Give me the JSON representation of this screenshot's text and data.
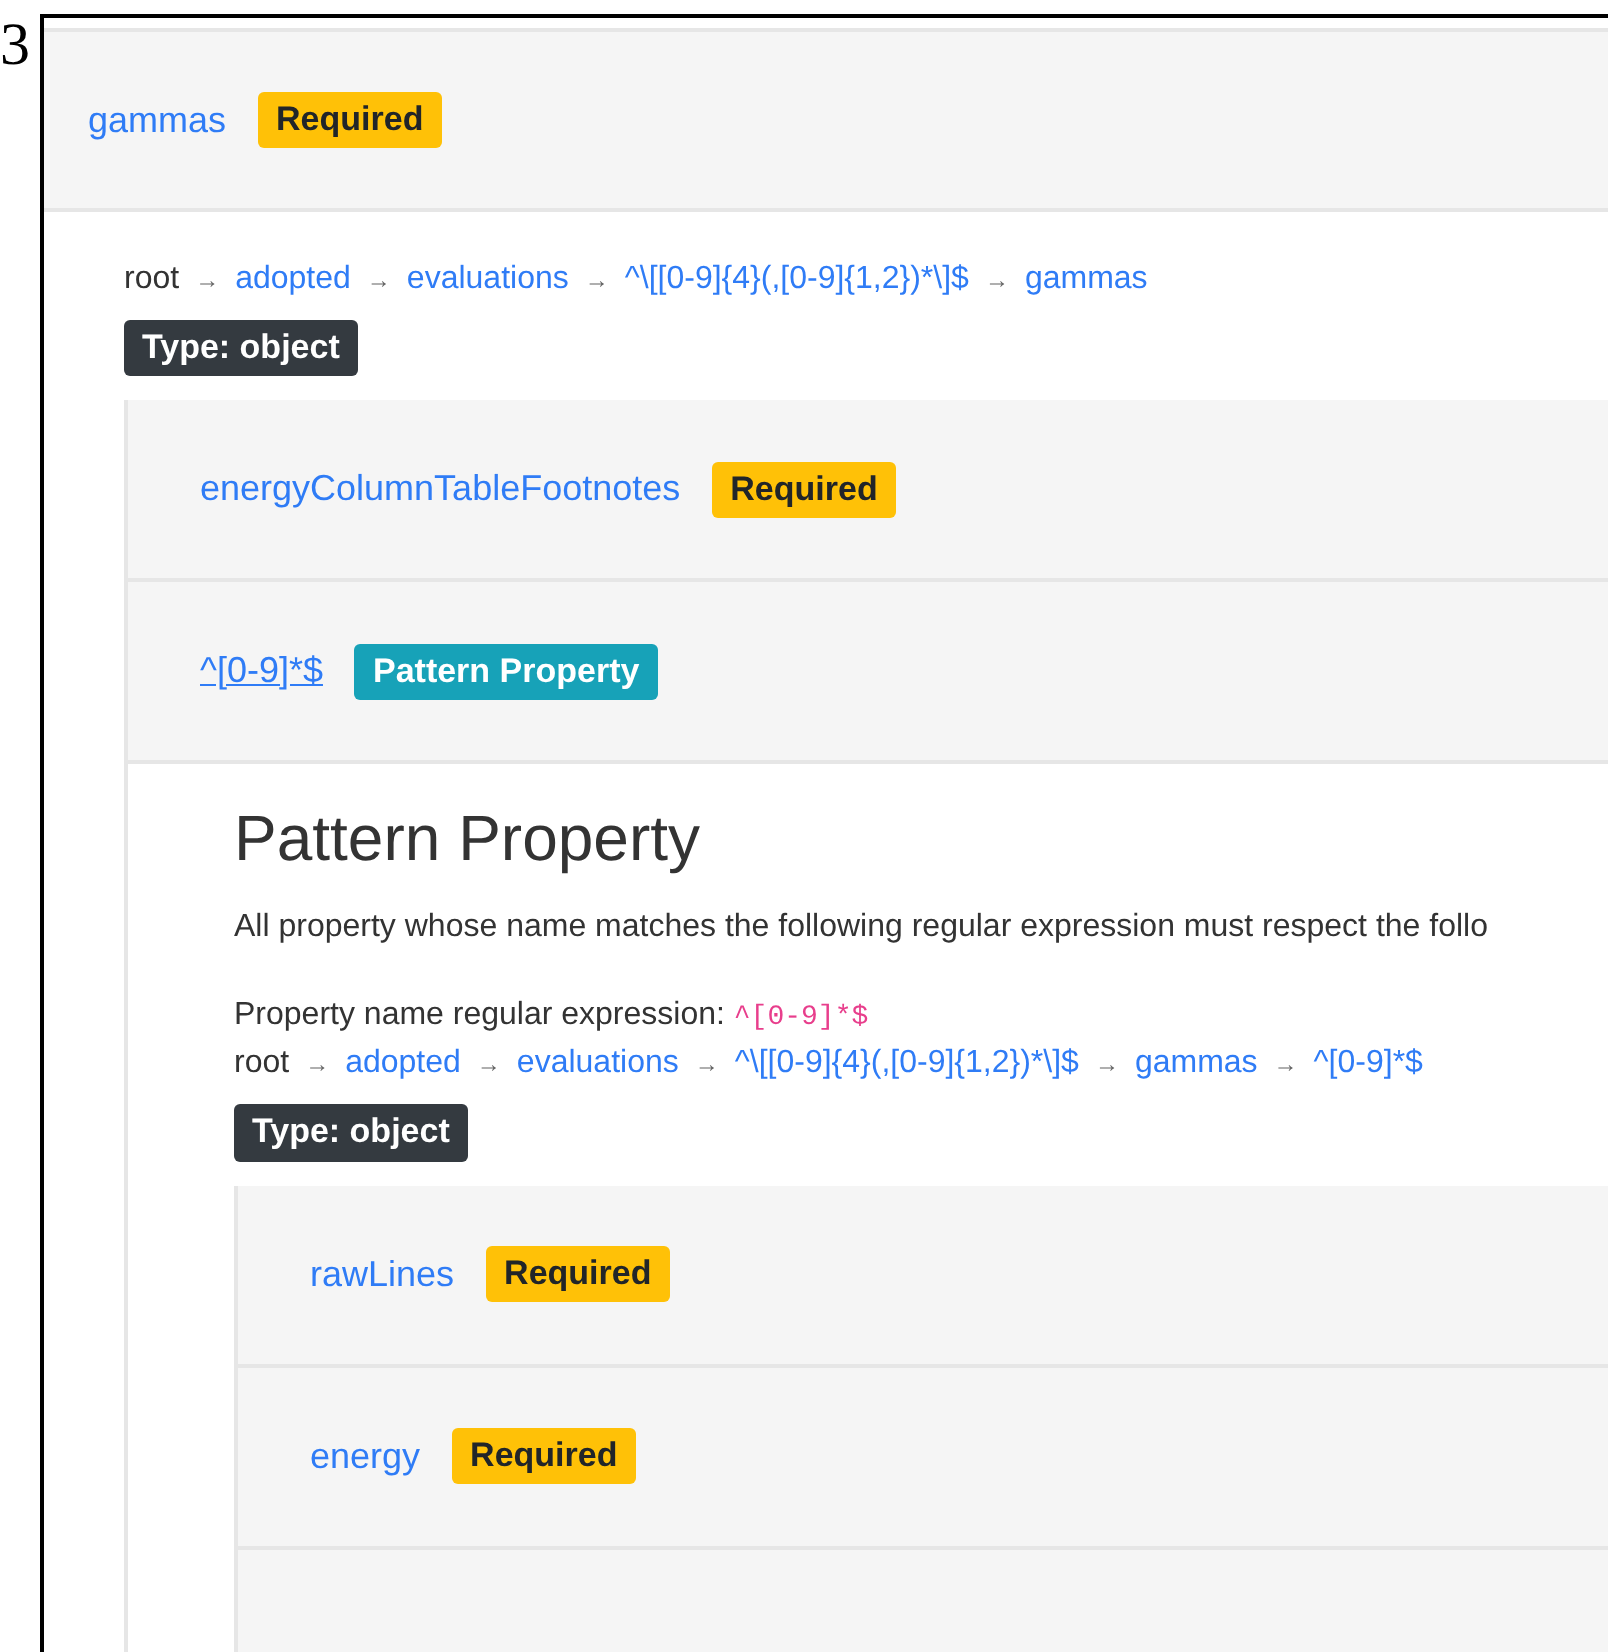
{
  "figure_label": "3",
  "property": {
    "name": "gammas",
    "badge": {
      "text": "Required",
      "kind": "required"
    }
  },
  "breadcrumb": {
    "separator": "→",
    "items": [
      {
        "text": "root",
        "link": false
      },
      {
        "text": "adopted",
        "link": true
      },
      {
        "text": "evaluations",
        "link": true
      },
      {
        "text": "^\\[[0-9]{4}(,[0-9]{1,2})*\\]$",
        "link": true
      },
      {
        "text": "gammas",
        "link": true
      }
    ]
  },
  "type_badge": "Type: object",
  "properties": [
    {
      "name": "energyColumnTableFootnotes",
      "badge": {
        "text": "Required",
        "kind": "required"
      },
      "expanded": false
    },
    {
      "name": "^[0-9]*$",
      "badge": {
        "text": "Pattern Property",
        "kind": "pattern"
      },
      "expanded": true,
      "detail": {
        "heading": "Pattern Property",
        "description": "All property whose name matches the following regular expression must respect the follo",
        "regex_label": "Property name regular expression:",
        "regex": "^[0-9]*$",
        "breadcrumb": {
          "separator": "→",
          "items": [
            {
              "text": "root",
              "link": false
            },
            {
              "text": "adopted",
              "link": true
            },
            {
              "text": "evaluations",
              "link": true
            },
            {
              "text": "^\\[[0-9]{4}(,[0-9]{1,2})*\\]$",
              "link": true
            },
            {
              "text": "gammas",
              "link": true
            },
            {
              "text": "^[0-9]*$",
              "link": true
            }
          ]
        },
        "type_badge": "Type: object",
        "properties": [
          {
            "name": "rawLines",
            "badge": {
              "text": "Required",
              "kind": "required"
            },
            "expanded": false
          },
          {
            "name": "energy",
            "badge": {
              "text": "Required",
              "kind": "required"
            },
            "expanded": false
          }
        ]
      }
    }
  ]
}
